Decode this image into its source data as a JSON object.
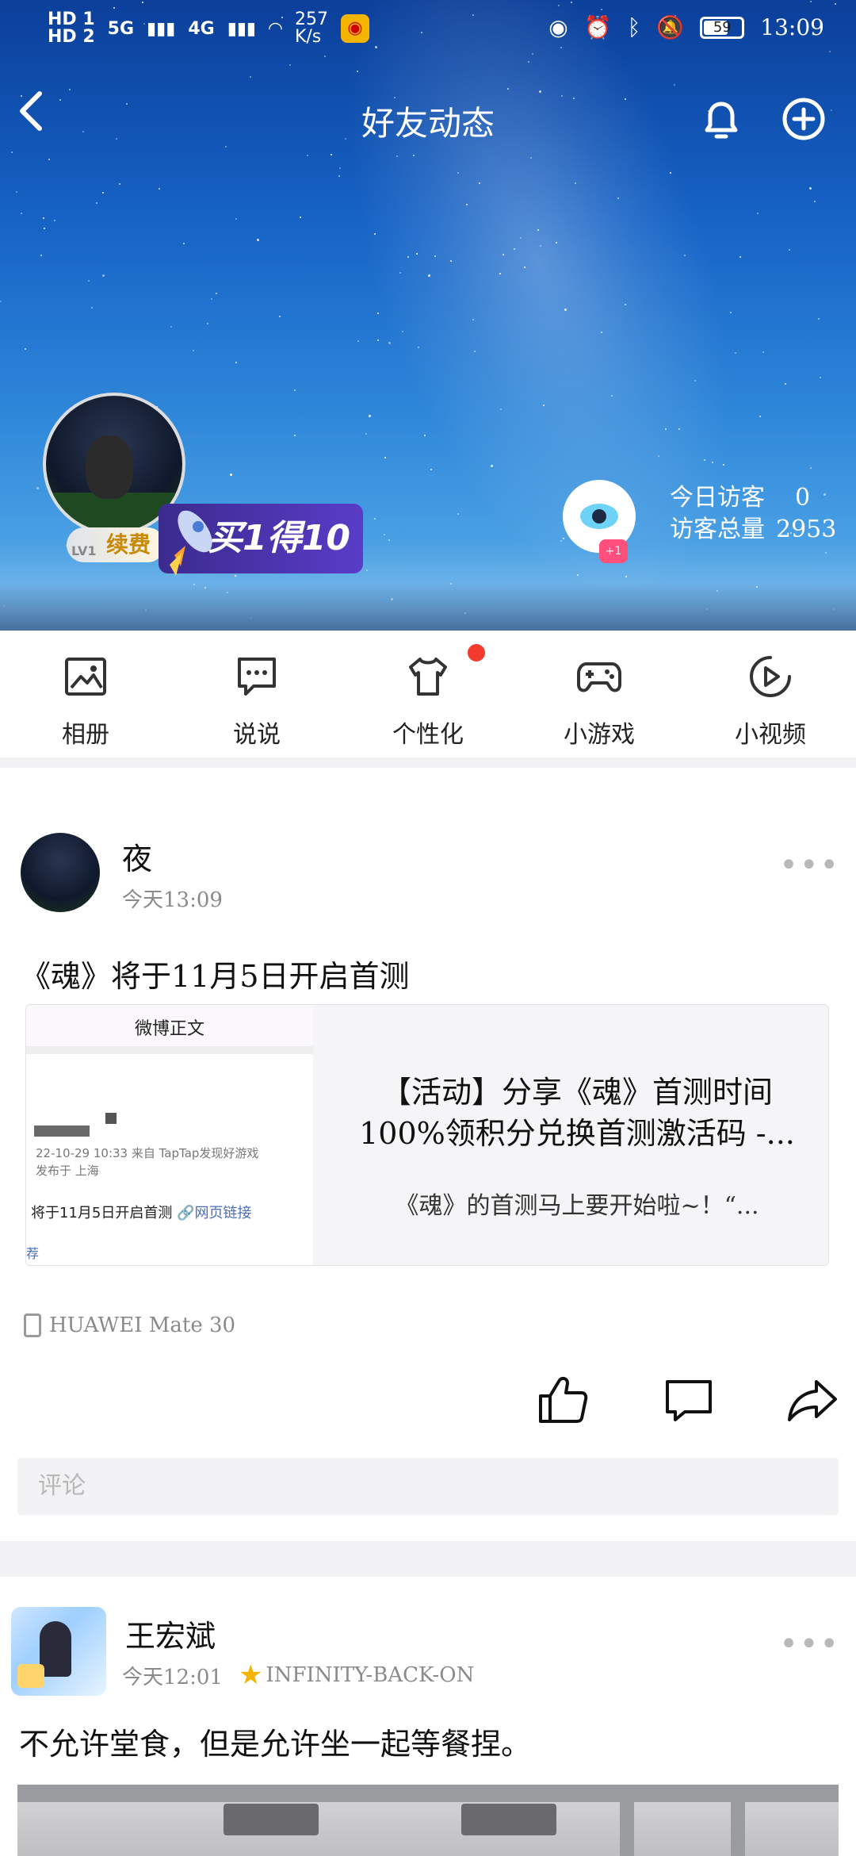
{
  "status_bar": {
    "sim": [
      "HD 1",
      "HD 2"
    ],
    "net": [
      "5G",
      "4G"
    ],
    "speed": "257",
    "speed_unit": "K/s",
    "battery": "59",
    "time": "13:09"
  },
  "header": {
    "title": "好友动态",
    "profile": {
      "level": "LV1",
      "renew_label": "续费",
      "promo_text": "买1得10"
    },
    "visitors": {
      "today_label": "今日访客",
      "today_value": "0",
      "total_label": "访客总量",
      "total_value": "2953",
      "badge": "+1"
    }
  },
  "quick_bar": {
    "items": [
      {
        "label": "相册",
        "icon": "album-icon"
      },
      {
        "label": "说说",
        "icon": "chat-icon"
      },
      {
        "label": "个性化",
        "icon": "tshirt-icon"
      },
      {
        "label": "小游戏",
        "icon": "gamepad-icon"
      },
      {
        "label": "小视频",
        "icon": "play-icon"
      }
    ]
  },
  "posts": [
    {
      "user": "夜",
      "time": "今天13:09",
      "text": "《魂》将于11月5日开启首测",
      "card": {
        "thumb_title": "微博正文",
        "thumb_meta_line1": "22-10-29 10:33  来自 TapTap发现好游戏",
        "thumb_meta_line2": "发布于 上海",
        "thumb_text": "将于11月5日开启首测",
        "thumb_link": "网页链接",
        "thumb_rec": "荐",
        "title": "【活动】分享《魂》首测时间100%领积分兑换首测激活码 -...",
        "desc": "《魂》的首测马上要开始啦~！“..."
      },
      "device": "HUAWEI Mate 30",
      "comment_placeholder": "评论"
    },
    {
      "user": "王宏斌",
      "time": "今天12:01",
      "tag": "INFINITY-BACK-ON",
      "text": "不允许堂食，但是允许坐一起等餐捏。"
    }
  ]
}
